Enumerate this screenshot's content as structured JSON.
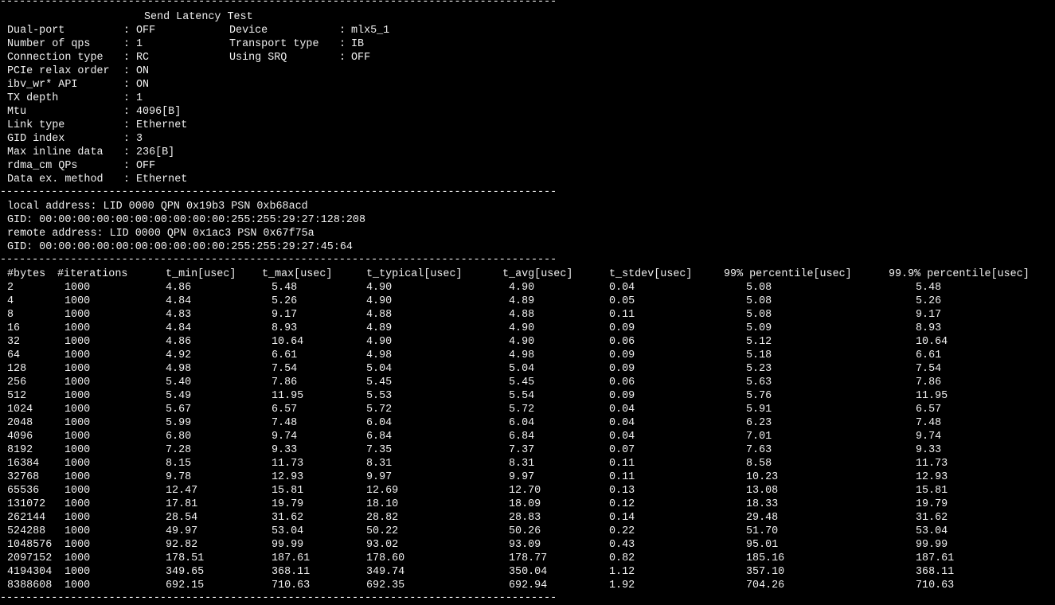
{
  "terminal": {
    "separator": "---------------------------------------------------------------------------------------",
    "header": {
      "title": "Send Latency Test",
      "config_lines": [
        {
          "key": "Dual-port",
          "value": "OFF",
          "key2": "Device",
          "value2": "mlx5_1"
        },
        {
          "key": "Number of qps",
          "value": "1",
          "key2": "Transport type",
          "value2": "IB"
        },
        {
          "key": "Connection type",
          "value": "RC",
          "key2": "Using SRQ",
          "value2": "OFF"
        },
        {
          "key": "PCIe relax order",
          "value": "ON"
        },
        {
          "key": "ibv_wr* API",
          "value": "ON"
        },
        {
          "key": "TX depth",
          "value": "1"
        },
        {
          "key": "Mtu",
          "value": "4096[B]"
        },
        {
          "key": "Link type",
          "value": "Ethernet"
        },
        {
          "key": "GID index",
          "value": "3"
        },
        {
          "key": "Max inline data",
          "value": "236[B]"
        },
        {
          "key": "rdma_cm QPs",
          "value": "OFF"
        },
        {
          "key": "Data ex. method",
          "value": "Ethernet"
        }
      ]
    },
    "addresses": [
      "local address: LID 0000 QPN 0x19b3 PSN 0xb68acd",
      "GID: 00:00:00:00:00:00:00:00:00:00:255:255:29:27:128:208",
      "remote address: LID 0000 QPN 0x1ac3 PSN 0x67f75a",
      "GID: 00:00:00:00:00:00:00:00:00:00:255:255:29:27:45:64"
    ],
    "results": {
      "columns": [
        "#bytes",
        "#iterations",
        "t_min[usec]",
        "t_max[usec]",
        "t_typical[usec]",
        "t_avg[usec]",
        "t_stdev[usec]",
        "99% percentile[usec]",
        "99.9% percentile[usec]"
      ],
      "rows": [
        [
          "2",
          "1000",
          "4.86",
          "5.48",
          "4.90",
          "4.90",
          "0.04",
          "5.08",
          "5.48"
        ],
        [
          "4",
          "1000",
          "4.84",
          "5.26",
          "4.90",
          "4.89",
          "0.05",
          "5.08",
          "5.26"
        ],
        [
          "8",
          "1000",
          "4.83",
          "9.17",
          "4.88",
          "4.88",
          "0.11",
          "5.08",
          "9.17"
        ],
        [
          "16",
          "1000",
          "4.84",
          "8.93",
          "4.89",
          "4.90",
          "0.09",
          "5.09",
          "8.93"
        ],
        [
          "32",
          "1000",
          "4.86",
          "10.64",
          "4.90",
          "4.90",
          "0.06",
          "5.12",
          "10.64"
        ],
        [
          "64",
          "1000",
          "4.92",
          "6.61",
          "4.98",
          "4.98",
          "0.09",
          "5.18",
          "6.61"
        ],
        [
          "128",
          "1000",
          "4.98",
          "7.54",
          "5.04",
          "5.04",
          "0.09",
          "5.23",
          "7.54"
        ],
        [
          "256",
          "1000",
          "5.40",
          "7.86",
          "5.45",
          "5.45",
          "0.06",
          "5.63",
          "7.86"
        ],
        [
          "512",
          "1000",
          "5.49",
          "11.95",
          "5.53",
          "5.54",
          "0.09",
          "5.76",
          "11.95"
        ],
        [
          "1024",
          "1000",
          "5.67",
          "6.57",
          "5.72",
          "5.72",
          "0.04",
          "5.91",
          "6.57"
        ],
        [
          "2048",
          "1000",
          "5.99",
          "7.48",
          "6.04",
          "6.04",
          "0.04",
          "6.23",
          "7.48"
        ],
        [
          "4096",
          "1000",
          "6.80",
          "9.74",
          "6.84",
          "6.84",
          "0.04",
          "7.01",
          "9.74"
        ],
        [
          "8192",
          "1000",
          "7.28",
          "9.33",
          "7.35",
          "7.37",
          "0.07",
          "7.63",
          "9.33"
        ],
        [
          "16384",
          "1000",
          "8.15",
          "11.73",
          "8.31",
          "8.31",
          "0.11",
          "8.58",
          "11.73"
        ],
        [
          "32768",
          "1000",
          "9.78",
          "12.93",
          "9.97",
          "9.97",
          "0.11",
          "10.23",
          "12.93"
        ],
        [
          "65536",
          "1000",
          "12.47",
          "15.81",
          "12.69",
          "12.70",
          "0.13",
          "13.08",
          "15.81"
        ],
        [
          "131072",
          "1000",
          "17.81",
          "19.79",
          "18.10",
          "18.09",
          "0.12",
          "18.33",
          "19.79"
        ],
        [
          "262144",
          "1000",
          "28.54",
          "31.62",
          "28.82",
          "28.83",
          "0.14",
          "29.48",
          "31.62"
        ],
        [
          "524288",
          "1000",
          "49.97",
          "53.04",
          "50.22",
          "50.26",
          "0.22",
          "51.70",
          "53.04"
        ],
        [
          "1048576",
          "1000",
          "92.82",
          "99.99",
          "93.02",
          "93.09",
          "0.43",
          "95.01",
          "99.99"
        ],
        [
          "2097152",
          "1000",
          "178.51",
          "187.61",
          "178.60",
          "178.77",
          "0.82",
          "185.16",
          "187.61"
        ],
        [
          "4194304",
          "1000",
          "349.65",
          "368.11",
          "349.74",
          "350.04",
          "1.12",
          "357.10",
          "368.11"
        ],
        [
          "8388608",
          "1000",
          "692.15",
          "710.63",
          "692.35",
          "692.94",
          "1.92",
          "704.26",
          "710.63"
        ]
      ]
    }
  },
  "colors": {
    "background": "#000000",
    "foreground": "#f0f0f0"
  }
}
